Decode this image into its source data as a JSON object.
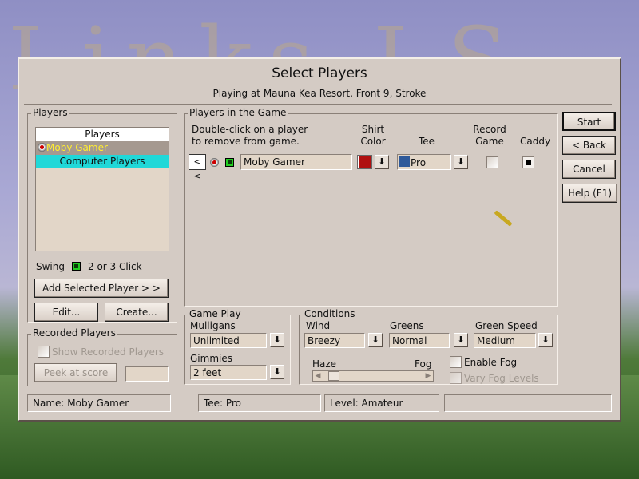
{
  "dialog": {
    "title": "Select Players",
    "subtitle": "Playing at Mauna Kea Resort, Front 9, Stroke"
  },
  "players_panel": {
    "legend": "Players",
    "list_header": "Players",
    "items": [
      {
        "label": "Moby Gamer",
        "selected": true
      },
      {
        "label": "Computer Players",
        "group": true
      }
    ],
    "swing_label": "Swing",
    "swing_value": "2 or 3 Click",
    "add_button": "Add Selected Player > >",
    "edit_button": "Edit...",
    "create_button": "Create..."
  },
  "recorded_panel": {
    "legend": "Recorded Players",
    "show_recorded": "Show Recorded Players",
    "show_recorded_checked": false,
    "peek_button": "Peek at score",
    "peek_value": ""
  },
  "game_panel": {
    "legend": "Players in the Game",
    "instruction_1": "Double-click on a player",
    "instruction_2": "to remove from game.",
    "col_shirt_1": "Shirt",
    "col_shirt_2": "Color",
    "col_tee": "Tee",
    "col_record_1": "Record",
    "col_record_2": "Game",
    "col_caddy": "Caddy",
    "rows": [
      {
        "remove": "< <",
        "name": "Moby Gamer",
        "shirt_color": "#b01010",
        "tee_color": "#2f5a9a",
        "tee": "Pro",
        "record": false,
        "caddy": true
      }
    ]
  },
  "gameplay": {
    "legend": "Game Play",
    "mulligans_label": "Mulligans",
    "mulligans": "Unlimited",
    "gimmies_label": "Gimmies",
    "gimmies": "2 feet"
  },
  "conditions": {
    "legend": "Conditions",
    "wind_label": "Wind",
    "wind": "Breezy",
    "greens_label": "Greens",
    "greens": "Normal",
    "speed_label": "Green Speed",
    "speed": "Medium",
    "haze_label": "Haze",
    "fog_label": "Fog",
    "fog_slider": 0.05,
    "enable_fog": "Enable Fog",
    "enable_fog_checked": false,
    "vary_fog": "Vary Fog Levels"
  },
  "buttons": {
    "start": "Start",
    "back": "< Back",
    "cancel": "Cancel",
    "help": "Help (F1)"
  },
  "status": {
    "name": "Name: Moby Gamer",
    "tee": "Tee: Pro",
    "level": "Level: Amateur",
    "extra": ""
  }
}
